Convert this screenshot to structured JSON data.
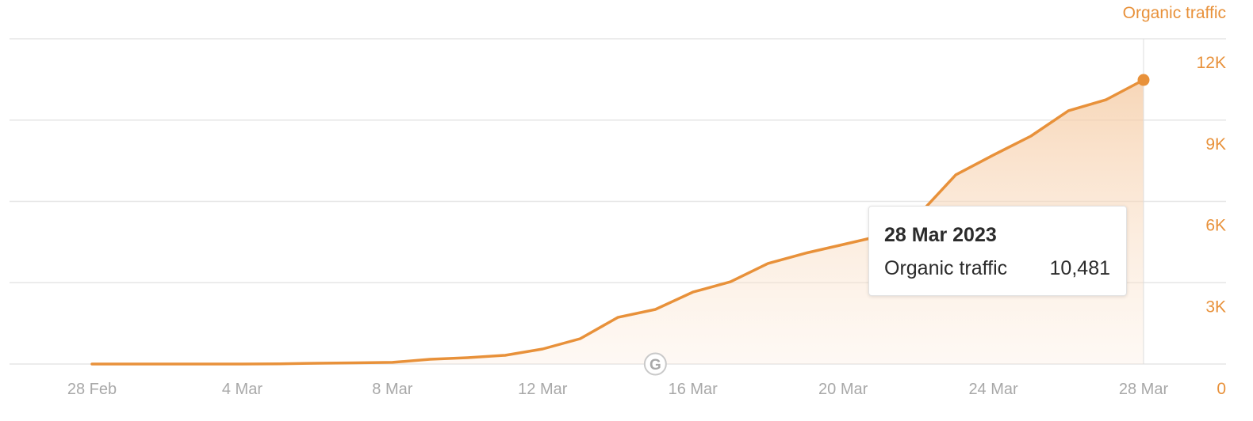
{
  "series_title": "Organic traffic",
  "tooltip": {
    "date": "28 Mar 2023",
    "metric_label": "Organic traffic",
    "metric_value": "10,481"
  },
  "marker_icon": "google-update-icon",
  "marker_label": "G",
  "colors": {
    "line": "#e8913a",
    "axis_label_y": "#e8913a",
    "axis_label_x": "#a8a8a8",
    "grid": "#e6e6e6"
  },
  "chart_data": {
    "type": "area",
    "title": "",
    "xlabel": "",
    "ylabel": "Organic traffic",
    "y_axis_position": "right",
    "grid": true,
    "ylim": [
      0,
      12000
    ],
    "y_ticks": [
      0,
      3000,
      6000,
      9000,
      12000
    ],
    "y_tick_labels": [
      "0",
      "3K",
      "6K",
      "9K",
      "12K"
    ],
    "x_tick_labels": [
      "28 Feb",
      "4 Mar",
      "8 Mar",
      "12 Mar",
      "16 Mar",
      "20 Mar",
      "24 Mar",
      "28 Mar"
    ],
    "x_tick_indices": [
      0,
      4,
      8,
      12,
      16,
      20,
      24,
      28
    ],
    "x": [
      "28 Feb",
      "1 Mar",
      "2 Mar",
      "3 Mar",
      "4 Mar",
      "5 Mar",
      "6 Mar",
      "7 Mar",
      "8 Mar",
      "9 Mar",
      "10 Mar",
      "11 Mar",
      "12 Mar",
      "13 Mar",
      "14 Mar",
      "15 Mar",
      "16 Mar",
      "17 Mar",
      "18 Mar",
      "19 Mar",
      "20 Mar",
      "21 Mar",
      "22 Mar",
      "23 Mar",
      "24 Mar",
      "25 Mar",
      "26 Mar",
      "27 Mar",
      "28 Mar"
    ],
    "series": [
      {
        "name": "Organic traffic",
        "values": [
          0,
          0,
          0,
          0,
          0,
          10,
          30,
          45,
          60,
          175,
          235,
          320,
          555,
          935,
          1720,
          2015,
          2655,
          3035,
          3710,
          4090,
          4410,
          4730,
          5490,
          6980,
          7710,
          8410,
          9345,
          9750,
          10481
        ]
      }
    ],
    "highlighted_point": {
      "x": "28 Mar",
      "value": 10481
    },
    "annotations": [
      {
        "x": "15 Mar",
        "label": "G",
        "type": "google-update-marker"
      }
    ]
  }
}
